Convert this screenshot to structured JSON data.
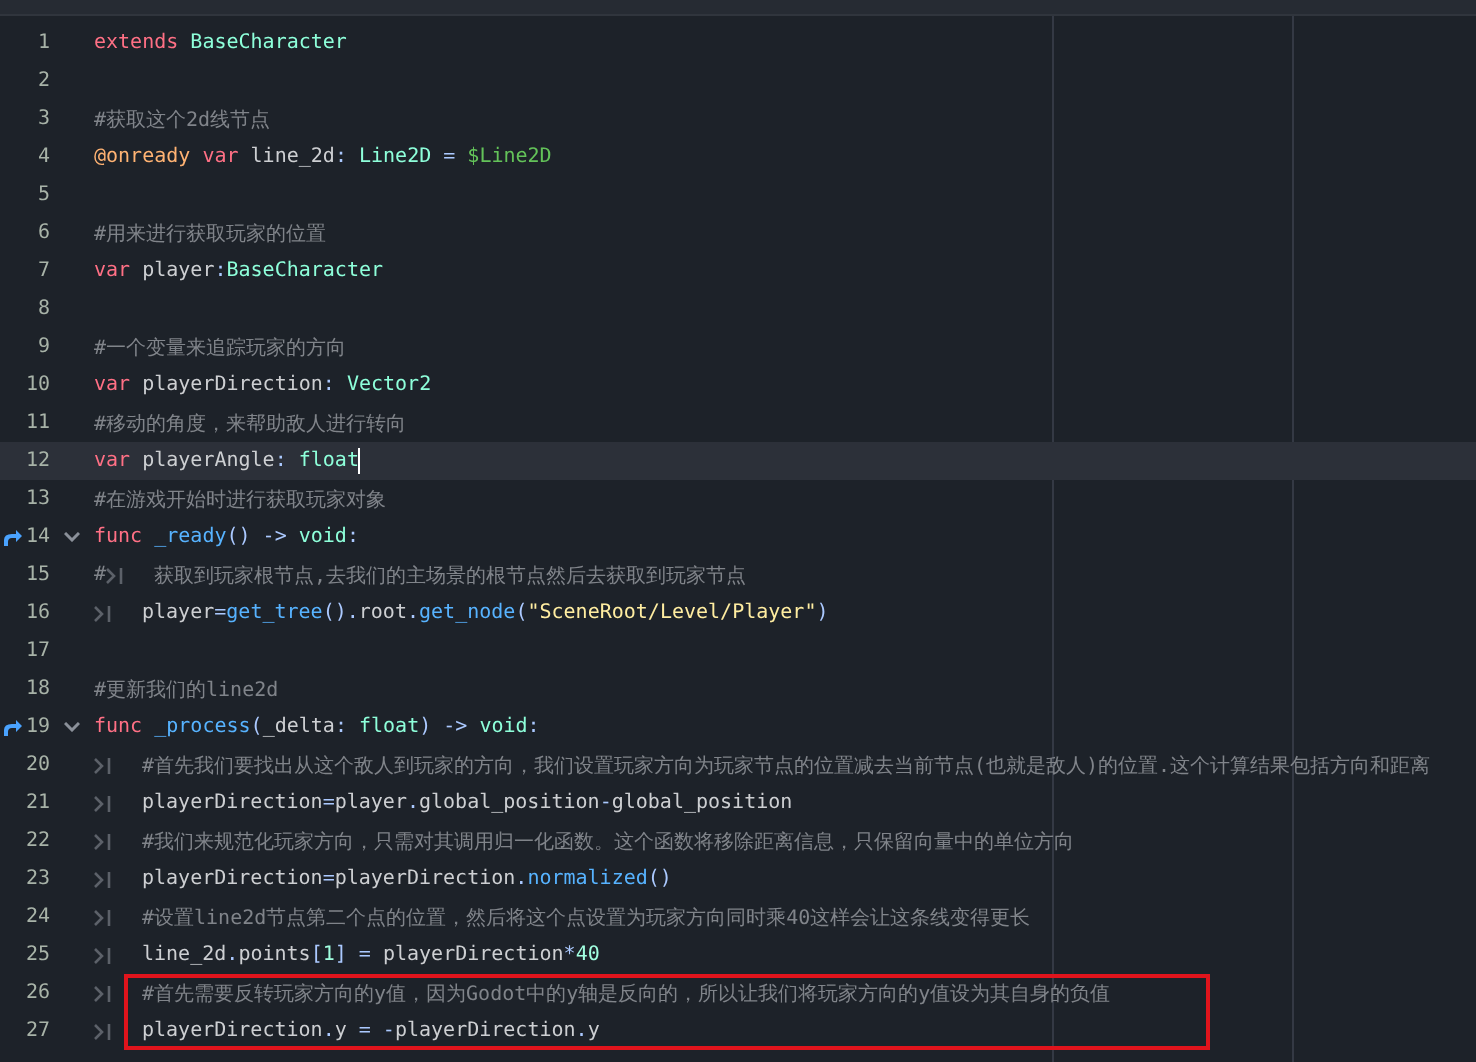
{
  "editor": {
    "lines": [
      {
        "number": "1",
        "tokens": [
          {
            "kind": "keyword",
            "text": "extends "
          },
          {
            "kind": "type",
            "text": "BaseCharacter"
          }
        ]
      },
      {
        "number": "2"
      },
      {
        "number": "3",
        "tokens": [
          {
            "kind": "comment",
            "text": "#获取这个2d线节点"
          }
        ]
      },
      {
        "number": "4",
        "tokens": [
          {
            "kind": "annotation",
            "text": "@onready "
          },
          {
            "kind": "keyword",
            "text": "var "
          },
          {
            "kind": "plain",
            "text": "line_2d"
          },
          {
            "kind": "symbol",
            "text": ": "
          },
          {
            "kind": "type",
            "text": "Line2D"
          },
          {
            "kind": "symbol",
            "text": " = "
          },
          {
            "kind": "nodepath",
            "text": "$Line2D"
          }
        ]
      },
      {
        "number": "5"
      },
      {
        "number": "6",
        "tokens": [
          {
            "kind": "comment",
            "text": "#用来进行获取玩家的位置"
          }
        ]
      },
      {
        "number": "7",
        "tokens": [
          {
            "kind": "keyword",
            "text": "var "
          },
          {
            "kind": "plain",
            "text": "player"
          },
          {
            "kind": "symbol",
            "text": ":"
          },
          {
            "kind": "type",
            "text": "BaseCharacter"
          }
        ]
      },
      {
        "number": "8"
      },
      {
        "number": "9",
        "tokens": [
          {
            "kind": "comment",
            "text": "#一个变量来追踪玩家的方向"
          }
        ]
      },
      {
        "number": "10",
        "tokens": [
          {
            "kind": "keyword",
            "text": "var "
          },
          {
            "kind": "plain",
            "text": "playerDirection"
          },
          {
            "kind": "symbol",
            "text": ": "
          },
          {
            "kind": "type",
            "text": "Vector2"
          }
        ]
      },
      {
        "number": "11",
        "tokens": [
          {
            "kind": "comment",
            "text": "#移动的角度，来帮助敌人进行转向"
          }
        ]
      },
      {
        "number": "12",
        "current": true,
        "tokens": [
          {
            "kind": "keyword",
            "text": "var "
          },
          {
            "kind": "plain",
            "text": "playerAngle"
          },
          {
            "kind": "symbol",
            "text": ": "
          },
          {
            "kind": "type",
            "text": "float"
          }
        ]
      },
      {
        "number": "13",
        "tokens": [
          {
            "kind": "comment",
            "text": "#在游戏开始时进行获取玩家对象"
          }
        ]
      },
      {
        "number": "14",
        "override": true,
        "foldable": true,
        "tokens": [
          {
            "kind": "keyword",
            "text": "func "
          },
          {
            "kind": "function",
            "text": "_ready"
          },
          {
            "kind": "symbol",
            "text": "() -> "
          },
          {
            "kind": "type",
            "text": "void"
          },
          {
            "kind": "symbol",
            "text": ":"
          }
        ]
      },
      {
        "number": "15",
        "tokens": [
          {
            "kind": "comment",
            "text": "#"
          },
          {
            "kind": "tab"
          },
          {
            "kind": "comment",
            "text": "获取到玩家根节点,去我们的主场景的根节点然后去获取到玩家节点"
          }
        ]
      },
      {
        "number": "16",
        "tokens": [
          {
            "kind": "tab"
          },
          {
            "kind": "plain",
            "text": "player"
          },
          {
            "kind": "symbol",
            "text": "="
          },
          {
            "kind": "call",
            "text": "get_tree"
          },
          {
            "kind": "symbol",
            "text": "()."
          },
          {
            "kind": "plain",
            "text": "root"
          },
          {
            "kind": "symbol",
            "text": "."
          },
          {
            "kind": "call",
            "text": "get_node"
          },
          {
            "kind": "symbol",
            "text": "("
          },
          {
            "kind": "string",
            "text": "\"SceneRoot/Level/Player\""
          },
          {
            "kind": "symbol",
            "text": ")"
          }
        ]
      },
      {
        "number": "17"
      },
      {
        "number": "18",
        "tokens": [
          {
            "kind": "comment",
            "text": "#更新我们的line2d"
          }
        ]
      },
      {
        "number": "19",
        "override": true,
        "foldable": true,
        "tokens": [
          {
            "kind": "keyword",
            "text": "func "
          },
          {
            "kind": "function",
            "text": "_process"
          },
          {
            "kind": "symbol",
            "text": "("
          },
          {
            "kind": "plain",
            "text": "_delta"
          },
          {
            "kind": "symbol",
            "text": ": "
          },
          {
            "kind": "type",
            "text": "float"
          },
          {
            "kind": "symbol",
            "text": ") -> "
          },
          {
            "kind": "type",
            "text": "void"
          },
          {
            "kind": "symbol",
            "text": ":"
          }
        ]
      },
      {
        "number": "20",
        "tokens": [
          {
            "kind": "tab"
          },
          {
            "kind": "comment",
            "text": "#首先我们要找出从这个敌人到玩家的方向，我们设置玩家方向为玩家节点的位置减去当前节点(也就是敌人)的位置.这个计算结果包括方向和距离"
          }
        ]
      },
      {
        "number": "21",
        "tokens": [
          {
            "kind": "tab"
          },
          {
            "kind": "plain",
            "text": "playerDirection"
          },
          {
            "kind": "symbol",
            "text": "="
          },
          {
            "kind": "plain",
            "text": "player"
          },
          {
            "kind": "symbol",
            "text": "."
          },
          {
            "kind": "plain",
            "text": "global_position"
          },
          {
            "kind": "symbol",
            "text": "-"
          },
          {
            "kind": "plain",
            "text": "global_position"
          }
        ]
      },
      {
        "number": "22",
        "tokens": [
          {
            "kind": "tab"
          },
          {
            "kind": "comment",
            "text": "#我们来规范化玩家方向，只需对其调用归一化函数。这个函数将移除距离信息，只保留向量中的单位方向"
          }
        ]
      },
      {
        "number": "23",
        "tokens": [
          {
            "kind": "tab"
          },
          {
            "kind": "plain",
            "text": "playerDirection"
          },
          {
            "kind": "symbol",
            "text": "="
          },
          {
            "kind": "plain",
            "text": "playerDirection"
          },
          {
            "kind": "symbol",
            "text": "."
          },
          {
            "kind": "call",
            "text": "normalized"
          },
          {
            "kind": "symbol",
            "text": "()"
          }
        ]
      },
      {
        "number": "24",
        "tokens": [
          {
            "kind": "tab"
          },
          {
            "kind": "comment",
            "text": "#设置line2d节点第二个点的位置，然后将这个点设置为玩家方向同时乘40这样会让这条线变得更长"
          }
        ]
      },
      {
        "number": "25",
        "tokens": [
          {
            "kind": "tab"
          },
          {
            "kind": "plain",
            "text": "line_2d"
          },
          {
            "kind": "symbol",
            "text": "."
          },
          {
            "kind": "plain",
            "text": "points"
          },
          {
            "kind": "symbol",
            "text": "["
          },
          {
            "kind": "number",
            "text": "1"
          },
          {
            "kind": "symbol",
            "text": "] = "
          },
          {
            "kind": "plain",
            "text": "playerDirection"
          },
          {
            "kind": "symbol",
            "text": "*"
          },
          {
            "kind": "number",
            "text": "40"
          }
        ]
      },
      {
        "number": "26",
        "highlighted": true,
        "tokens": [
          {
            "kind": "tab"
          },
          {
            "kind": "comment",
            "text": "#首先需要反转玩家方向的y值，因为Godot中的y轴是反向的，所以让我们将玩家方向的y值设为其自身的负值"
          }
        ]
      },
      {
        "number": "27",
        "highlighted": true,
        "tokens": [
          {
            "kind": "tab"
          },
          {
            "kind": "plain",
            "text": "playerDirection"
          },
          {
            "kind": "symbol",
            "text": "."
          },
          {
            "kind": "plain",
            "text": "y"
          },
          {
            "kind": "symbol",
            "text": " = -"
          },
          {
            "kind": "plain",
            "text": "playerDirection"
          },
          {
            "kind": "symbol",
            "text": "."
          },
          {
            "kind": "plain",
            "text": "y"
          }
        ]
      }
    ]
  }
}
